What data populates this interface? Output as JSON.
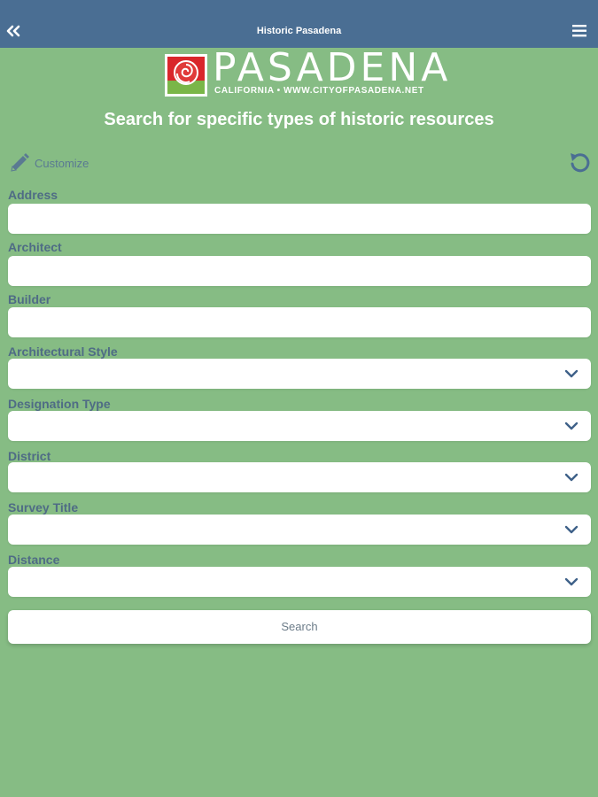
{
  "header": {
    "title": "Historic Pasadena",
    "back_icon": "double-chevron-left-icon",
    "menu_icon": "hamburger-menu-icon",
    "bar_color": "#4a6e93"
  },
  "logo": {
    "wordmark": "PASADENA",
    "tagline": "CALIFORNIA • WWW.CITYOFPASADENA.NET",
    "emblem_icon": "rose-emblem-icon"
  },
  "headline": "Search for specific types of historic resources",
  "toolbar": {
    "customize_label": "Customize",
    "customize_icon": "pencil-icon",
    "reset_icon": "reset-icon"
  },
  "form": {
    "address_label": "Address",
    "address_value": "",
    "architect_label": "Architect",
    "architect_value": "",
    "builder_label": "Builder",
    "builder_value": "",
    "style_label": "Architectural Style",
    "style_value": "",
    "designation_label": "Designation Type",
    "designation_value": "",
    "district_label": "District",
    "district_value": "",
    "survey_label": "Survey Title",
    "survey_value": "",
    "distance_label": "Distance",
    "distance_value": ""
  },
  "search_label": "Search",
  "colors": {
    "background": "#86bc84",
    "label_text": "#4f6c85",
    "chevron": "#3f6189"
  }
}
